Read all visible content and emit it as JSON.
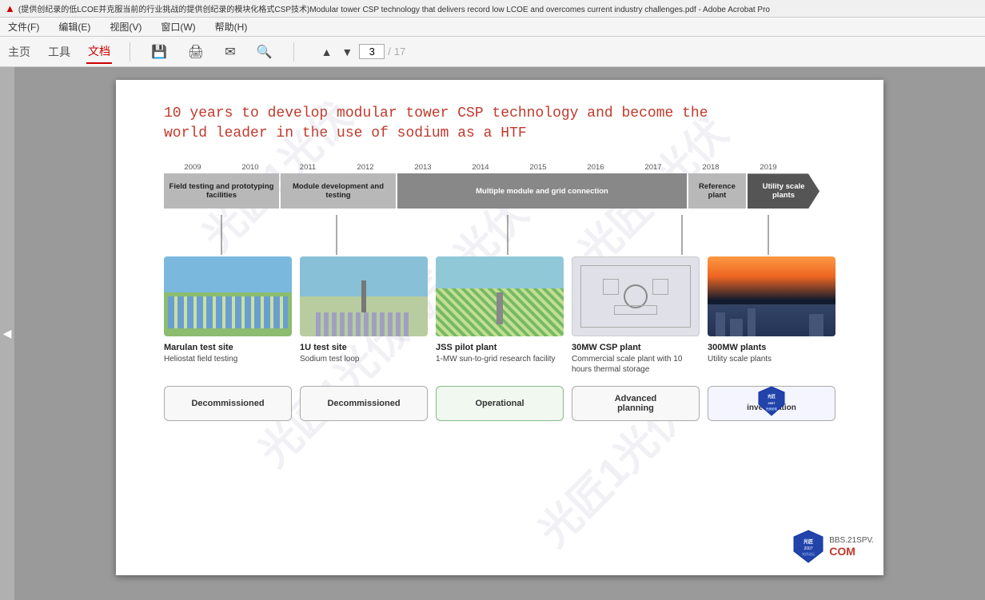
{
  "titlebar": {
    "icon": "▲",
    "text": "(提供创纪录的低LCOE并克服当前的行业挑战的提供创纪录的模块化格式CSP技术)Modular tower CSP technology that delivers record low LCOE and overcomes current industry challenges.pdf - Adobe Acrobat Pro",
    "app": "Adobe Acrobat Pro"
  },
  "menubar": {
    "items": [
      "文件(F)",
      "编辑(E)",
      "视图(V)",
      "窗口(W)",
      "帮助(H)"
    ]
  },
  "toolbar": {
    "tabs": [
      "主页",
      "工具",
      "文档"
    ],
    "active_tab": "文档",
    "page_current": "3",
    "page_total": "17"
  },
  "page": {
    "title": "10 years to develop modular tower CSP technology and become the\nworld leader in the use of sodium as a HTF",
    "years": [
      "2009",
      "2010",
      "2011",
      "2012",
      "2013",
      "2014",
      "2015",
      "2016",
      "2017",
      "2018",
      "2019"
    ],
    "phases": [
      {
        "label": "Field testing and prototyping facilities",
        "color": "gray",
        "span": 2
      },
      {
        "label": "Module development and testing",
        "color": "gray",
        "span": 2
      },
      {
        "label": "Multiple module and grid connection",
        "color": "dark-gray",
        "span": 5
      },
      {
        "label": "Reference plant",
        "color": "gray",
        "span": 1
      },
      {
        "label": "Utility scale plants",
        "color": "arrow",
        "span": 1
      }
    ],
    "plants": [
      {
        "id": "marulan",
        "name": "Marulan test site",
        "desc": "Heliostat field testing",
        "img_type": "marulan"
      },
      {
        "id": "1u",
        "name": "1U test site",
        "desc": "Sodium test loop",
        "img_type": "1u"
      },
      {
        "id": "jss",
        "name": "JSS pilot plant",
        "desc": "1-MW sun-to-grid research facility",
        "img_type": "jss"
      },
      {
        "id": "30mw",
        "name": "30MW CSP plant",
        "desc": "Commercial scale plant with 10 hours thermal storage",
        "img_type": "30mw"
      },
      {
        "id": "300mw",
        "name": "300MW plants",
        "desc": "Utility scale plants",
        "img_type": "300mw"
      }
    ],
    "statuses": [
      {
        "id": "decom1",
        "label": "Decommissioned",
        "type": "decommissioned"
      },
      {
        "id": "decom2",
        "label": "Decommissioned",
        "type": "decommissioned"
      },
      {
        "id": "operational",
        "label": "Operational",
        "type": "operational"
      },
      {
        "id": "advanced",
        "label": "Advanced planning",
        "type": "advanced"
      },
      {
        "id": "under",
        "label": "Under investigation",
        "type": "under"
      }
    ],
    "watermarks": [
      {
        "text": "光匠"
      },
      {
        "text": "光匠"
      }
    ]
  },
  "logo": {
    "shield_text": "2007",
    "line1": "光匠光伏论坛",
    "com": "COM",
    "url": "BBS.21SPV."
  }
}
